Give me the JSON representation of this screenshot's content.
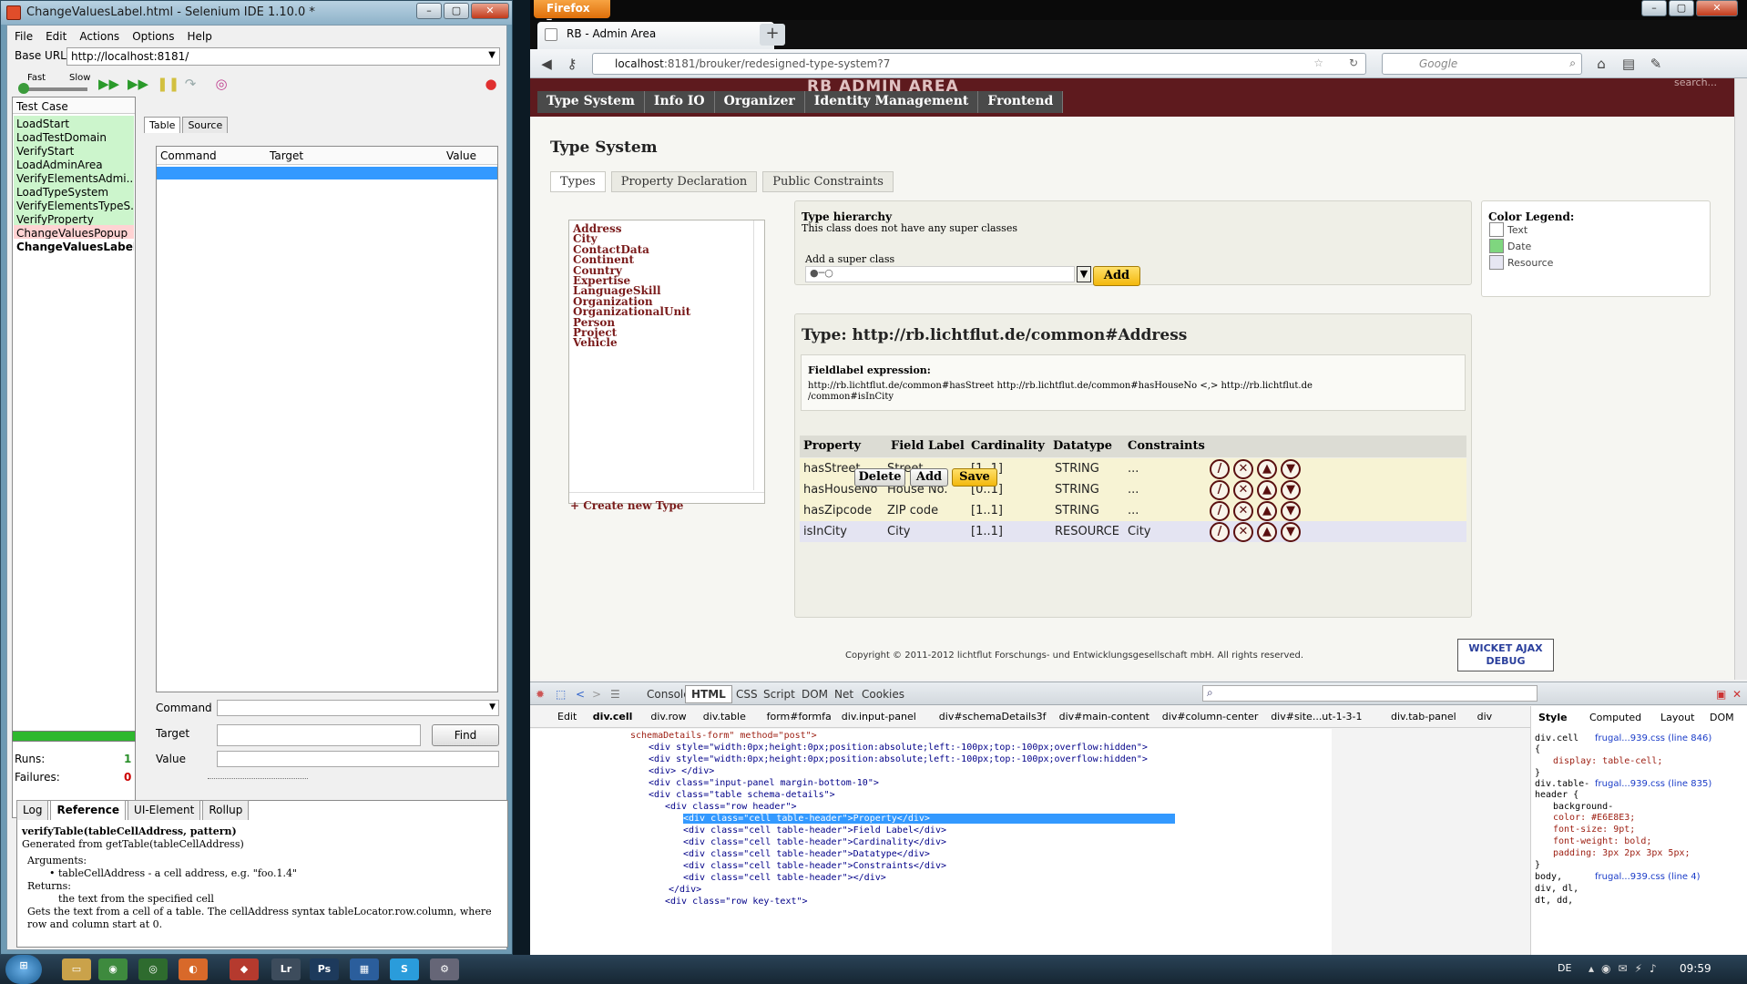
{
  "selenium": {
    "title": "ChangeValuesLabel.html - Selenium IDE 1.10.0 *",
    "menu": [
      "File",
      "Edit",
      "Actions",
      "Options",
      "Help"
    ],
    "base_url_label": "Base URL",
    "base_url": "http://localhost:8181/",
    "speed_fast": "Fast",
    "speed_slow": "Slow",
    "testcase_header": "Test Case",
    "testcases": [
      {
        "label": "LoadStart",
        "status": "pass"
      },
      {
        "label": "LoadTestDomain",
        "status": "pass"
      },
      {
        "label": "VerifyStart",
        "status": "pass"
      },
      {
        "label": "LoadAdminArea",
        "status": "pass"
      },
      {
        "label": "VerifyElementsAdmi...",
        "status": "pass"
      },
      {
        "label": "LoadTypeSystem",
        "status": "pass"
      },
      {
        "label": "VerifyElementsTypeS...",
        "status": "pass"
      },
      {
        "label": "VerifyProperty",
        "status": "pass"
      },
      {
        "label": "ChangeValuesPopup",
        "status": "fail"
      },
      {
        "label": "ChangeValuesLabel *",
        "status": "current"
      }
    ],
    "runs_label": "Runs:",
    "runs": "1",
    "failures_label": "Failures:",
    "failures": "0",
    "tabs": [
      "Table",
      "Source"
    ],
    "col_command": "Command",
    "col_target": "Target",
    "col_value": "Value",
    "field_command": "Command",
    "field_target": "Target",
    "field_value": "Value",
    "find": "Find",
    "bottom_tabs": [
      "Log",
      "Reference",
      "UI-Element",
      "Rollup"
    ],
    "ref": {
      "signature": "verifyTable(tableCellAddress, pattern)",
      "generated": "Generated from getTable(tableCellAddress)",
      "args_label": "Arguments:",
      "arg1": "tableCellAddress - a cell address, e.g. \"foo.1.4\"",
      "returns_label": "Returns:",
      "returns": "the text from the specified cell",
      "desc": "Gets the text from a cell of a table. The cellAddress syntax tableLocator.row.column, where row and column start at 0."
    }
  },
  "firefox": {
    "menu_button": "Firefox",
    "tab_title": "RB - Admin Area",
    "url_host": "localhost",
    "url_rest": ":8181/brouker/redesigned-type-system?7",
    "search_placeholder": "Google",
    "page": {
      "brand": "RB ADMIN AREA",
      "search": "search...",
      "nav": [
        "Type System",
        "Info IO",
        "Organizer",
        "Identity Management",
        "Frontend"
      ],
      "title": "Type System",
      "tabs": [
        "Types",
        "Property Declaration",
        "Public Constraints"
      ],
      "types": [
        "Address",
        "City",
        "ContactData",
        "Continent",
        "Country",
        "Expertise",
        "LanguageSkill",
        "Organization",
        "OrganizationalUnit",
        "Person",
        "Project",
        "Vehicle"
      ],
      "create_type": "+ Create new Type",
      "hierarchy_title": "Type hierarchy",
      "hierarchy_text": "This class does not have any super classes",
      "add_super_label": "Add a super class",
      "add_btn": "Add",
      "legend_title": "Color Legend:",
      "legend": [
        {
          "label": "Text",
          "color": "#ffffff"
        },
        {
          "label": "Date",
          "color": "#7fd67f"
        },
        {
          "label": "Resource",
          "color": "#e6e6f2"
        }
      ],
      "type_heading": "Type: http://rb.lichtflut.de/common#Address",
      "fieldlabel_title": "Fieldlabel expression:",
      "fieldlabel_line1": "http://rb.lichtflut.de/common#hasStreet http://rb.lichtflut.de/common#hasHouseNo <,> http://rb.lichtflut.de",
      "fieldlabel_line2": "/common#isInCity",
      "columns": [
        "Property",
        "Field Label",
        "Cardinality",
        "Datatype",
        "Constraints"
      ],
      "rows": [
        {
          "property": "hasStreet",
          "label": "Street",
          "card": "[1..1]",
          "type": "STRING",
          "constraints": "...",
          "bg": "#f7f3d4"
        },
        {
          "property": "hasHouseNo",
          "label": "House No.",
          "card": "[0..1]",
          "type": "STRING",
          "constraints": "...",
          "bg": "#f7f3d4"
        },
        {
          "property": "hasZipcode",
          "label": "ZIP code",
          "card": "[1..1]",
          "type": "STRING",
          "constraints": "...",
          "bg": "#f7f3d4"
        },
        {
          "property": "isInCity",
          "label": "City",
          "card": "[1..1]",
          "type": "RESOURCE",
          "constraints": "City",
          "bg": "#e4e4f2"
        }
      ],
      "delete_btn": "Delete",
      "add_row_btn": "Add",
      "save_btn": "Save",
      "copyright": "Copyright © 2011-2012 lichtflut Forschungs- und Entwicklungsgesellschaft mbH. All rights reserved.",
      "wicket_line1": "WICKET AJAX",
      "wicket_line2": "DEBUG"
    },
    "firebug": {
      "tabs": [
        "Console",
        "HTML",
        "CSS",
        "Script",
        "DOM",
        "Net",
        "Cookies"
      ],
      "crumbs": [
        "Edit",
        "div.cell",
        "div.row",
        "div.table",
        "form#formfa",
        "div.input-panel",
        "div#schemaDetails3f",
        "div#main-content",
        "div#column-center",
        "div#site...ut-1-3-1",
        "div.tab-panel",
        "div"
      ],
      "side_tabs": [
        "Style",
        "Computed",
        "Layout",
        "DOM"
      ],
      "code": [
        "schemaDetails-form\" method=\"post\">",
        "<div style=\"width:0px;height:0px;position:absolute;left:-100px;top:-100px;overflow:hidden\">",
        "<div style=\"width:0px;height:0px;position:absolute;left:-100px;top:-100px;overflow:hidden\">",
        "<div> </div>",
        "<div class=\"input-panel margin-bottom-10\">",
        "<div class=\"table schema-details\">",
        "<div class=\"row header\">",
        "<div class=\"cell table-header\">Property</div>",
        "<div class=\"cell table-header\">Field Label</div>",
        "<div class=\"cell table-header\">Cardinality</div>",
        "<div class=\"cell table-header\">Datatype</div>",
        "<div class=\"cell table-header\">Constraints</div>",
        "<div class=\"cell table-header\"></div>",
        "</div>",
        "<div class=\"row key-text\">"
      ],
      "css": [
        "div.cell",
        "frugal...939.css (line 846)",
        "{",
        "display: table-cell;",
        "}",
        "div.table-",
        "frugal...939.css (line 835)",
        "header {",
        "background-",
        "color: #E6E8E3;",
        "font-size: 9pt;",
        "font-weight: bold;",
        "padding: 3px 2px 3px 5px;",
        "}",
        "body,",
        "frugal...939.css (line 4)",
        "div, dl,",
        "dt, dd,"
      ]
    }
  },
  "taskbar": {
    "lang": "DE",
    "time": "09:59"
  }
}
